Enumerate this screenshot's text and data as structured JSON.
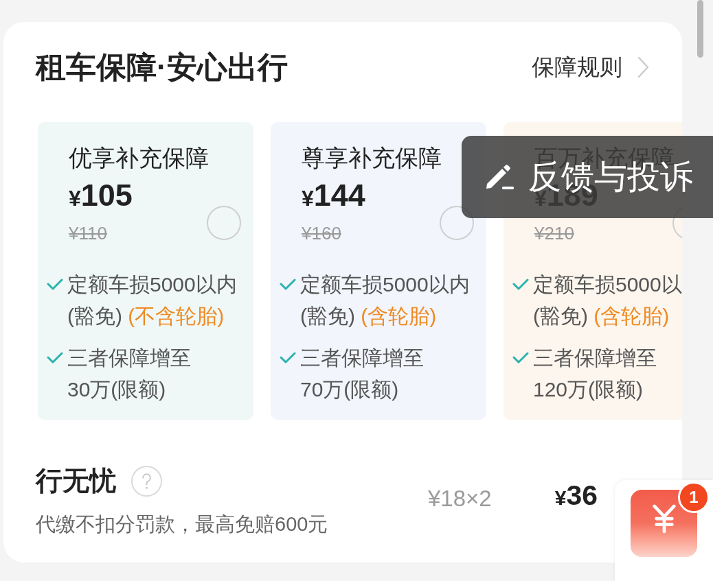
{
  "header": {
    "title": "租车保障·安心出行",
    "link": "保障规则"
  },
  "cards": [
    {
      "title": "优享补充保障",
      "price_symbol": "¥",
      "price": "105",
      "original_price": "¥110",
      "selected": false,
      "color": "#eff8f7",
      "features": [
        {
          "lines": [
            "定额车损5000以内",
            "(豁免)"
          ],
          "note": "(不含轮胎)"
        },
        {
          "lines": [
            "三者保障增至",
            "30万(限额)"
          ]
        }
      ]
    },
    {
      "title": "尊享补充保障",
      "price_symbol": "¥",
      "price": "144",
      "original_price": "¥160",
      "selected": false,
      "color": "#f2f5fc",
      "features": [
        {
          "lines": [
            "定额车损5000以内",
            "(豁免)"
          ],
          "note": "(含轮胎)"
        },
        {
          "lines": [
            "三者保障增至",
            "70万(限额)"
          ]
        }
      ]
    },
    {
      "title": "百万补充保障",
      "price_symbol": "¥",
      "price": "189",
      "original_price": "¥210",
      "selected": false,
      "color": "#fdf6ee",
      "features": [
        {
          "lines": [
            "定额车损5000以",
            "(豁免)"
          ],
          "note": "(含轮胎)"
        },
        {
          "lines": [
            "三者保障增至",
            "120万(限额)"
          ]
        }
      ]
    }
  ],
  "addon": {
    "title": "行无忧",
    "description": "代缴不扣分罚款，最高免赔600元",
    "unit_price": "¥18×2",
    "price_symbol": "¥",
    "price": "36"
  },
  "feedback_button": {
    "label": "反馈与投诉"
  },
  "coupon": {
    "badge": "1"
  }
}
